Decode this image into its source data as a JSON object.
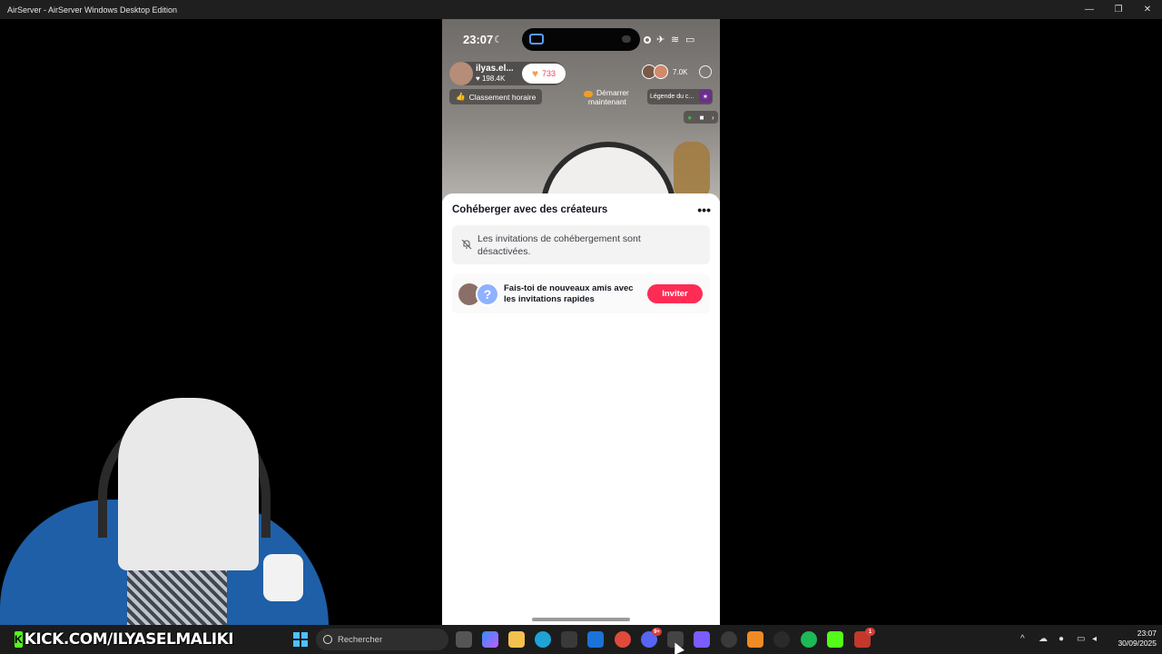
{
  "window": {
    "title": "AirServer - AirServer Windows Desktop Edition",
    "minimize_glyph": "—",
    "maximize_glyph": "❐",
    "close_glyph": "✕"
  },
  "phone": {
    "status": {
      "time": "23:07",
      "moon": "☾",
      "airplane": "✈",
      "wifi": "≋",
      "battery": "▭"
    },
    "live": {
      "host_name": "ilyas.el...",
      "host_likes": "♥ 198.4K",
      "follow_count": "733",
      "follow_icon": "♥",
      "viewer_count": "7.0K",
      "rank_label": "Classement horaire",
      "rank_icon": "👍",
      "start_label_line1": "Démarrer",
      "start_label_line2": "maintenant",
      "legend_label": "Légende du c...",
      "legend_star": "✶"
    },
    "sheet": {
      "title": "Cohéberger avec des créateurs",
      "more": "•••",
      "notice": "Les invitations de cohébergement sont désactivées.",
      "invite_text": "Fais-toi de nouveaux amis avec les invitations rapides",
      "invite_avatar_glyph": "?",
      "invite_button": "Inviter"
    }
  },
  "overlay": {
    "kick_logo": "K",
    "kick_text": "KICK.COM/ILYASELMALIKI"
  },
  "taskbar": {
    "search_placeholder": "Rechercher",
    "discord_badge": "9+",
    "app_badge": "1",
    "time": "23:07",
    "date": "30/09/2025"
  },
  "colors": {
    "accent_pink": "#fe2c55",
    "kick_green": "#53fc18",
    "windows_blue": "#4cc2ff"
  }
}
